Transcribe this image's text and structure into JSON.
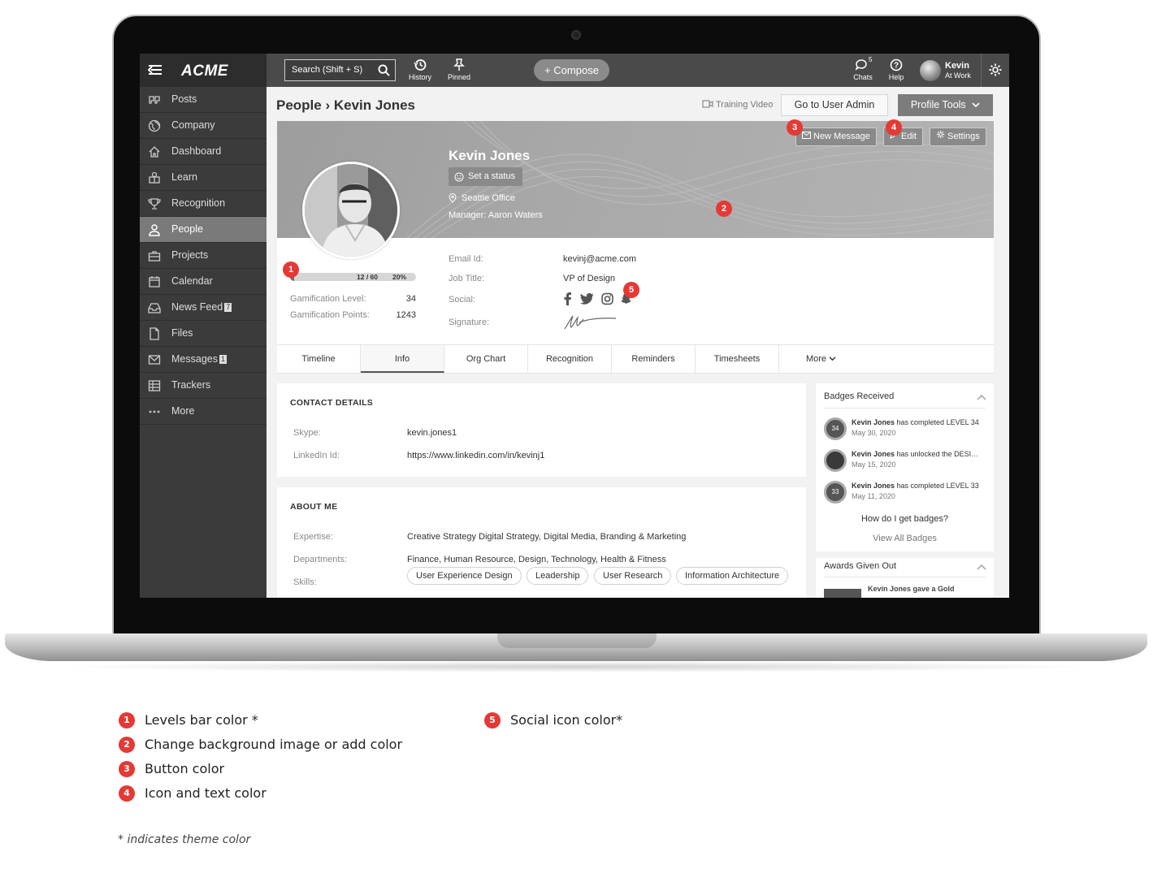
{
  "app": {
    "logo": "ACME"
  },
  "topbar": {
    "search_placeholder": "Search (Shift + S)",
    "history": "History",
    "pinned": "Pinned",
    "compose": "+ Compose",
    "chats": "Chats",
    "chats_count": "5",
    "help": "Help",
    "user_name": "Kevin",
    "user_status": "At Work"
  },
  "sidebar": {
    "items": [
      {
        "label": "Posts",
        "icon": "quote-icon"
      },
      {
        "label": "Company",
        "icon": "globe-icon"
      },
      {
        "label": "Dashboard",
        "icon": "home-icon"
      },
      {
        "label": "Learn",
        "icon": "learn-icon"
      },
      {
        "label": "Recognition",
        "icon": "trophy-icon"
      },
      {
        "label": "People",
        "icon": "person-icon",
        "active": true
      },
      {
        "label": "Projects",
        "icon": "briefcase-icon"
      },
      {
        "label": "Calendar",
        "icon": "calendar-icon"
      },
      {
        "label": "News Feed",
        "icon": "inbox-icon",
        "badge": "7"
      },
      {
        "label": "Files",
        "icon": "file-icon"
      },
      {
        "label": "Messages",
        "icon": "mail-icon",
        "badge": "1"
      },
      {
        "label": "Trackers",
        "icon": "grid-icon"
      },
      {
        "label": "More",
        "icon": "dots-icon"
      }
    ]
  },
  "header": {
    "breadcrumb": "People › Kevin Jones",
    "training_video": "Training Video",
    "go_to_admin": "Go to User Admin",
    "profile_tools": "Profile Tools"
  },
  "profile": {
    "name": "Kevin Jones",
    "set_status": "Set a status",
    "office": "Seattle Office",
    "manager": "Manager:  Aaron Waters",
    "new_message": "New Message",
    "edit": "Edit",
    "settings": "Settings",
    "level_text": "12 / 60",
    "level_percent_text": "20%",
    "level_fraction": 0.2,
    "gamification_level_label": "Gamification Level:",
    "gamification_level": "34",
    "gamification_points_label": "Gamification Points:",
    "gamification_points": "1243",
    "email_label": "Email Id:",
    "email": "kevinj@acme.com",
    "job_title_label": "Job Title:",
    "job_title": "VP of Design",
    "social_label": "Social:",
    "signature_label": "Signature:"
  },
  "tabs": [
    "Timeline",
    "Info",
    "Org Chart",
    "Recognition",
    "Reminders",
    "Timesheets",
    "More"
  ],
  "active_tab": "Info",
  "contact": {
    "title": "CONTACT DETAILS",
    "skype_label": "Skype:",
    "skype": "kevin.jones1",
    "linkedin_label": "LinkedIn Id:",
    "linkedin": "https://www.linkedin.com/in/kevinj1"
  },
  "about": {
    "title": "ABOUT ME",
    "expertise_label": "Expertise:",
    "expertise": "Creative Strategy Digital Strategy, Digital Media, Branding & Marketing",
    "departments_label": "Departments:",
    "departments": "Finance, Human Resource, Design, Technology, Health & Fitness",
    "skills_label": "Skills:",
    "skills": [
      "User Experience Design",
      "Leadership",
      "User Research",
      "Information Architecture"
    ]
  },
  "badges": {
    "title": "Badges Received",
    "items": [
      {
        "who": "Kevin Jones",
        "text": " has completed LEVEL 34",
        "date": "May 30, 2020",
        "badge": "34"
      },
      {
        "who": "Kevin Jones",
        "text": " has unlocked the DESIGN badge",
        "date": "May 15, 2020",
        "badge": ""
      },
      {
        "who": "Kevin Jones",
        "text": " has completed LEVEL 33",
        "date": "May 11, 2020",
        "badge": "33"
      }
    ],
    "how_link": "How do I get badges?",
    "view_all": "View All Badges"
  },
  "awards": {
    "title": "Awards Given Out",
    "first": "Kevin Jones gave a Gold"
  },
  "markers": [
    "1",
    "2",
    "3",
    "4",
    "5"
  ],
  "legend": [
    {
      "num": "1",
      "text": "Levels bar color *"
    },
    {
      "num": "2",
      "text": "Change background image or add color"
    },
    {
      "num": "3",
      "text": "Button color"
    },
    {
      "num": "4",
      "text": "Icon and text color"
    },
    {
      "num": "5",
      "text": "Social icon color*"
    }
  ],
  "footnote": "* indicates theme color",
  "colors": {
    "marker": "#e53935",
    "sidebar": "#3b3b3b",
    "topbar": "#4a4a4a"
  }
}
